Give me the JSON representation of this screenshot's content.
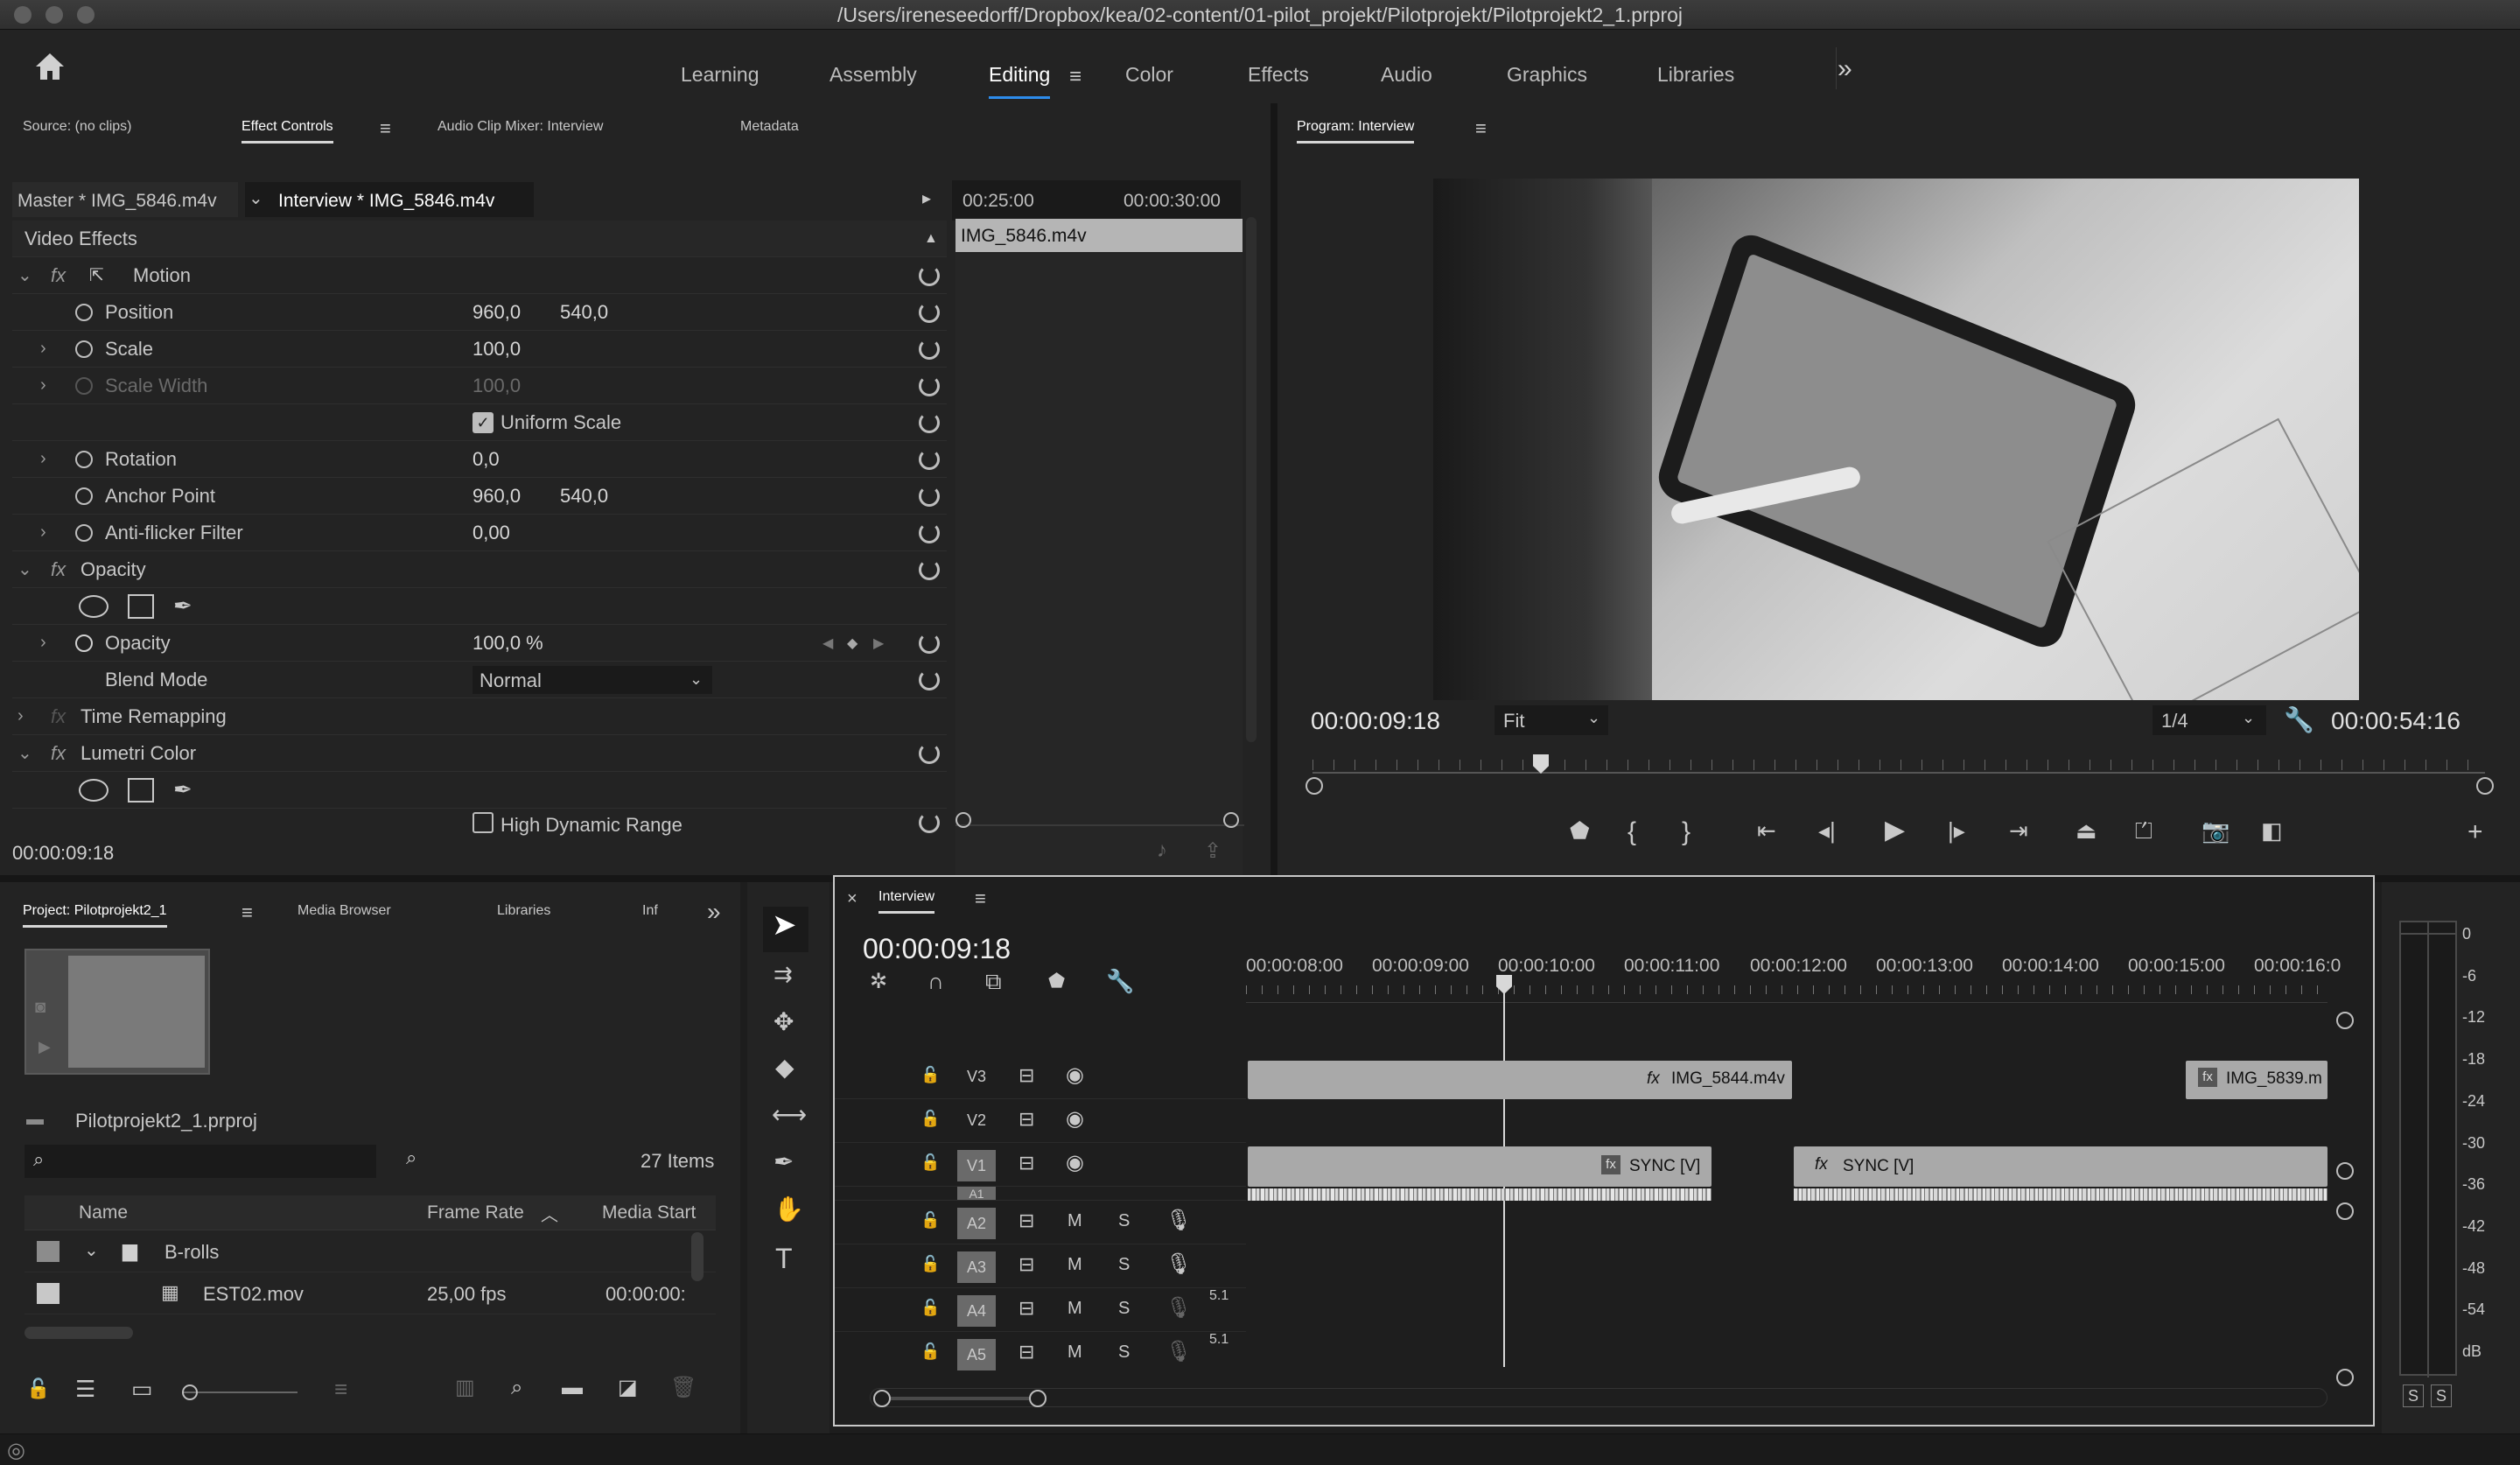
{
  "window": {
    "title": "/Users/ireneseedorff/Dropbox/kea/02-content/01-pilot_projekt/Pilotprojekt/Pilotprojekt2_1.prproj"
  },
  "workspaces": {
    "items": [
      "Learning",
      "Assembly",
      "Editing",
      "Color",
      "Effects",
      "Audio",
      "Graphics",
      "Libraries"
    ],
    "active": "Editing",
    "more": "»"
  },
  "source_panel": {
    "tabs": [
      "Source: (no clips)",
      "Effect Controls",
      "Audio Clip Mixer: Interview",
      "Metadata"
    ],
    "active_tab": "Effect Controls",
    "master_label": "Master * IMG_5846.m4v",
    "sequence_label": "Interview * IMG_5846.m4v",
    "mini_ruler": [
      "00:25:00",
      "00:00:30:00"
    ],
    "mini_clip": "IMG_5846.m4v",
    "video_effects_header": "Video Effects",
    "motion": "Motion",
    "position_label": "Position",
    "position_x": "960,0",
    "position_y": "540,0",
    "scale_label": "Scale",
    "scale_value": "100,0",
    "scale_width_label": "Scale Width",
    "scale_width_value": "100,0",
    "uniform_scale_label": "Uniform Scale",
    "rotation_label": "Rotation",
    "rotation_value": "0,0",
    "anchor_label": "Anchor Point",
    "anchor_x": "960,0",
    "anchor_y": "540,0",
    "antiflicker_label": "Anti-flicker Filter",
    "antiflicker_value": "0,00",
    "opacity_group": "Opacity",
    "opacity_label": "Opacity",
    "opacity_value": "100,0 %",
    "blend_label": "Blend Mode",
    "blend_value": "Normal",
    "time_remap": "Time Remapping",
    "lumetri": "Lumetri Color",
    "hdr_label": "High Dynamic Range",
    "timecode": "00:00:09:18"
  },
  "program_monitor": {
    "title": "Program: Interview",
    "timecode": "00:00:09:18",
    "fit": "Fit",
    "resolution": "1/4",
    "duration": "00:00:54:16"
  },
  "project_panel": {
    "tabs": [
      "Project: Pilotprojekt2_1",
      "Media Browser",
      "Libraries",
      "Inf"
    ],
    "active_tab": "Project: Pilotprojekt2_1",
    "project_file": "Pilotprojekt2_1.prproj",
    "search_placeholder": "",
    "item_count": "27 Items",
    "columns": [
      "Name",
      "Frame Rate",
      "Media Start"
    ],
    "rows": [
      {
        "name": "B-rolls",
        "frame_rate": "",
        "media_start": ""
      },
      {
        "name": "EST02.mov",
        "frame_rate": "25,00 fps",
        "media_start": "00:00:00:"
      }
    ]
  },
  "timeline": {
    "tab": "Interview",
    "timecode": "00:00:09:18",
    "ruler": [
      "00:00:08:00",
      "00:00:09:00",
      "00:00:10:00",
      "00:00:11:00",
      "00:00:12:00",
      "00:00:13:00",
      "00:00:14:00",
      "00:00:15:00",
      "00:00:16:0"
    ],
    "tracks": [
      {
        "name": "V3",
        "clips": [
          "IMG_5844.m4v",
          "IMG_5839.m"
        ]
      },
      {
        "name": "V2",
        "clips": []
      },
      {
        "name": "V1",
        "clips": [
          "SYNC [V]",
          "SYNC [V]"
        ]
      },
      {
        "name": "A1",
        "clips": []
      },
      {
        "name": "A2",
        "clips": []
      },
      {
        "name": "A3",
        "clips": []
      },
      {
        "name": "A4",
        "clips": []
      },
      {
        "name": "A5",
        "clips": []
      }
    ],
    "audio_badge": "5.1",
    "m_label": "M",
    "s_label": "S"
  },
  "meters": {
    "scale": [
      "0",
      "-6",
      "-12",
      "-18",
      "-24",
      "-30",
      "-36",
      "-42",
      "-48",
      "-54",
      "dB"
    ],
    "solo": [
      "S",
      "S"
    ]
  },
  "colors": {
    "accent": "#2d8ceb",
    "panel": "#232323",
    "clip": "#a9a9a9"
  }
}
